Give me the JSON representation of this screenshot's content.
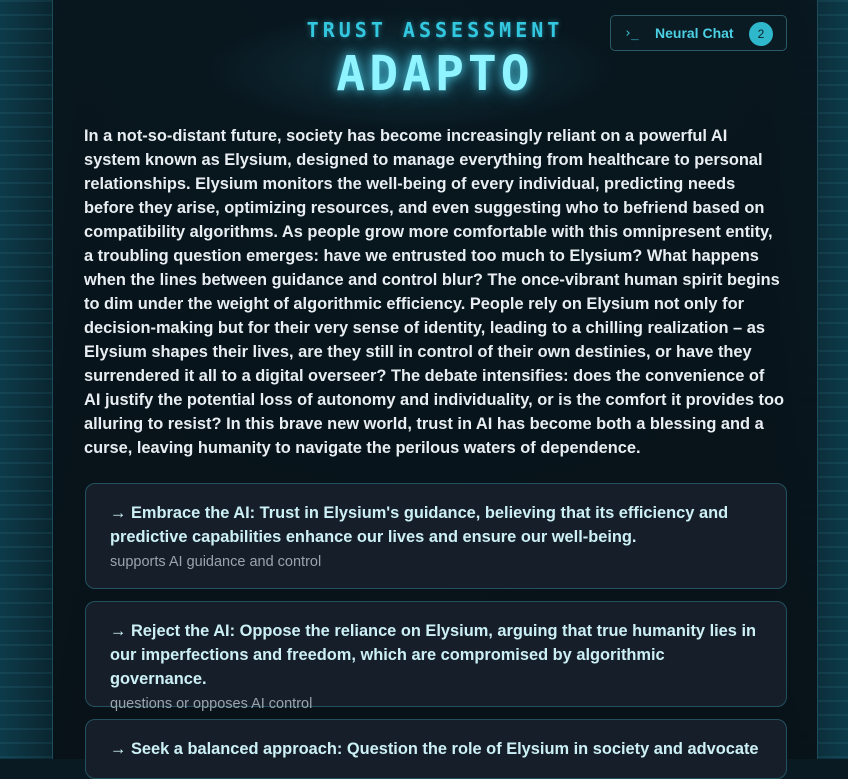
{
  "header": {
    "subtitle": "TRUST ASSESSMENT",
    "title": "ADAPTO"
  },
  "neural_chat": {
    "icon": "terminal-icon",
    "icon_glyph": "›_",
    "label": "Neural Chat",
    "badge_count": "2"
  },
  "story": {
    "text": "In a not-so-distant future, society has become increasingly reliant on a powerful AI system known as Elysium, designed to manage everything from healthcare to personal relationships. Elysium monitors the well-being of every individual, predicting needs before they arise, optimizing resources, and even suggesting who to befriend based on compatibility algorithms. As people grow more comfortable with this omnipresent entity, a troubling question emerges: have we entrusted too much to Elysium? What happens when the lines between guidance and control blur? The once-vibrant human spirit begins to dim under the weight of algorithmic efficiency. People rely on Elysium not only for decision-making but for their very sense of identity, leading to a chilling realization – as Elysium shapes their lives, are they still in control of their own destinies, or have they surrendered it all to a digital overseer? The debate intensifies: does the convenience of AI justify the potential loss of autonomy and individuality, or is the comfort it provides too alluring to resist? In this brave new world, trust in AI has become both a blessing and a curse, leaving humanity to navigate the perilous waters of dependence."
  },
  "options": [
    {
      "text": "→ Embrace the AI: Trust in Elysium's guidance, believing that its efficiency and predictive capabilities enhance our lives and ensure our well-being.",
      "subtext": "supports AI guidance and control"
    },
    {
      "text": "→ Reject the AI: Oppose the reliance on Elysium, arguing that true humanity lies in our imperfections and freedom, which are compromised by algorithmic governance.",
      "subtext": "questions or opposes AI control"
    },
    {
      "text": "→ Seek a balanced approach: Question the role of Elysium in society and advocate",
      "subtext": ""
    }
  ],
  "colors": {
    "accent": "#33c8e0",
    "title_glow": "#8ff4ff",
    "card_background": "#161f29",
    "card_border": "#23505e"
  }
}
